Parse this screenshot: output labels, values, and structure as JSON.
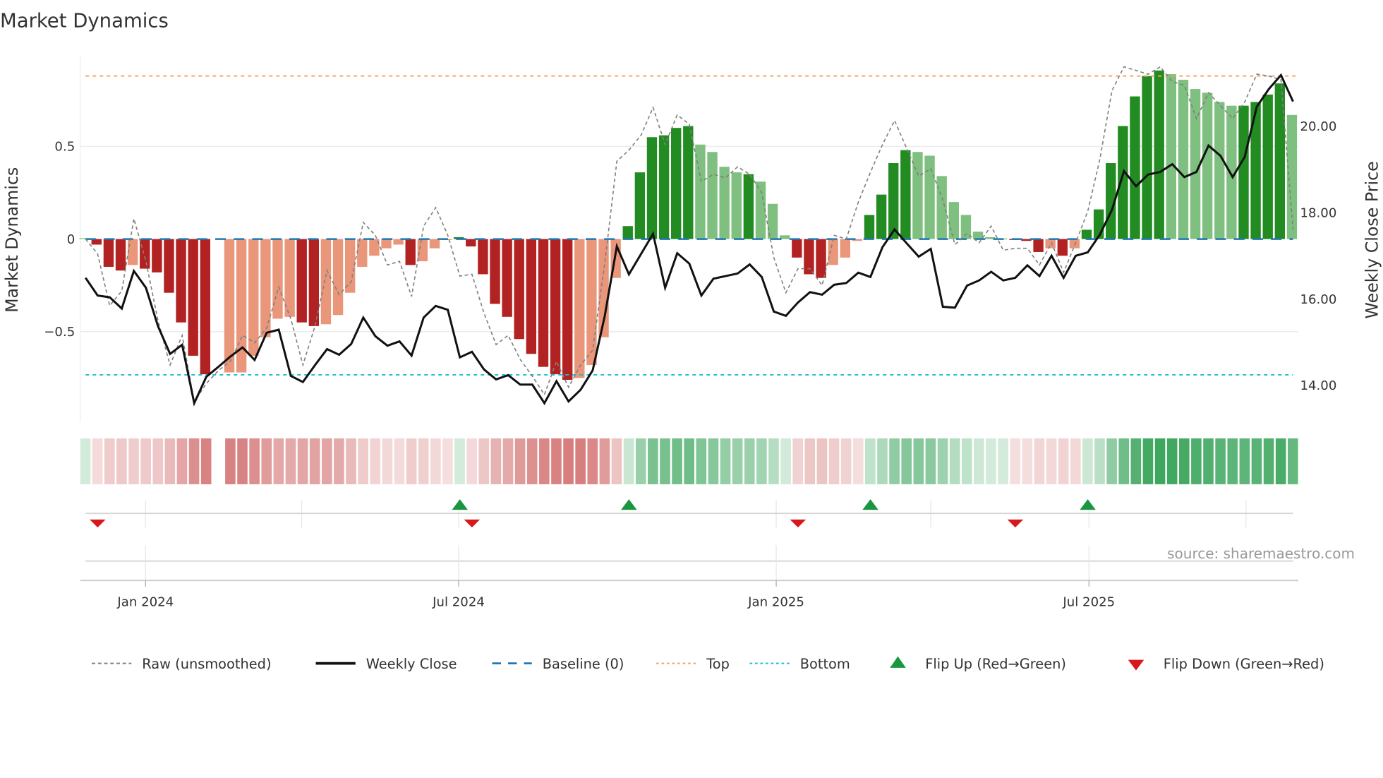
{
  "chart_data": {
    "type": "bar",
    "title": "Market Dynamics",
    "ylabel": "Market Dynamics",
    "y2label": "Weekly Close Price",
    "ylim": [
      -0.9,
      0.95
    ],
    "y2lim": [
      13.4,
      21.5
    ],
    "yticks": [
      {
        "value": 0.5,
        "label": "0.5"
      },
      {
        "value": 0,
        "label": "0"
      },
      {
        "value": -0.5,
        "label": "−0.5"
      }
    ],
    "y2ticks": [
      {
        "value": 20,
        "label": "20.00"
      },
      {
        "value": 18,
        "label": "18.00"
      },
      {
        "value": 16,
        "label": "16.00"
      },
      {
        "value": 14,
        "label": "14.00"
      }
    ],
    "xticks": [
      {
        "week": 4.97,
        "label": "Jan 2024"
      },
      {
        "week": 30.9,
        "label": "Jul 2024"
      },
      {
        "week": 57.2,
        "label": "Jan 2025"
      },
      {
        "week": 83.1,
        "label": "Jul 2025"
      }
    ],
    "minor_xticks": [
      17.9,
      70.0,
      96.1
    ],
    "top_level": 0.88,
    "bottom_level": -0.733,
    "baseline": 0,
    "dynamics": [
      0.005,
      -0.03,
      -0.15,
      -0.17,
      -0.14,
      -0.16,
      -0.18,
      -0.29,
      -0.45,
      -0.63,
      -0.73,
      null,
      -0.72,
      -0.72,
      -0.63,
      -0.53,
      -0.43,
      -0.42,
      -0.45,
      -0.47,
      -0.46,
      -0.41,
      -0.29,
      -0.15,
      -0.09,
      -0.05,
      -0.03,
      -0.14,
      -0.12,
      -0.05,
      -0.005,
      0.01,
      -0.04,
      -0.19,
      -0.35,
      -0.42,
      -0.54,
      -0.62,
      -0.69,
      -0.73,
      -0.76,
      -0.75,
      -0.68,
      -0.53,
      -0.21,
      0.07,
      0.36,
      0.55,
      0.56,
      0.6,
      0.61,
      0.51,
      0.47,
      0.39,
      0.36,
      0.35,
      0.31,
      0.19,
      0.02,
      -0.1,
      -0.19,
      -0.21,
      -0.14,
      -0.1,
      -0.01,
      0.13,
      0.24,
      0.41,
      0.48,
      0.47,
      0.45,
      0.34,
      0.2,
      0.13,
      0.04,
      0.01,
      0.003,
      -0.005,
      -0.01,
      -0.07,
      -0.05,
      -0.09,
      -0.05,
      0.05,
      0.16,
      0.41,
      0.61,
      0.77,
      0.88,
      0.91,
      0.89,
      0.86,
      0.81,
      0.79,
      0.74,
      0.72,
      0.72,
      0.74,
      0.78,
      0.84,
      0.67
    ],
    "bar_shade": [
      "lg",
      "dr",
      "dr",
      "dr",
      "lr",
      "dr",
      "dr",
      "dr",
      "dr",
      "dr",
      "dr",
      null,
      "lr",
      "lr",
      "lr",
      "lr",
      "lr",
      "lr",
      "dr",
      "dr",
      "lr",
      "lr",
      "lr",
      "lr",
      "lr",
      "lr",
      "lr",
      "dr",
      "lr",
      "lr",
      "lr",
      "dg",
      "dr",
      "dr",
      "dr",
      "dr",
      "dr",
      "dr",
      "dr",
      "dr",
      "dr",
      "lr",
      "lr",
      "lr",
      "lr",
      "dg",
      "dg",
      "dg",
      "dg",
      "dg",
      "dg",
      "lg",
      "lg",
      "lg",
      "lg",
      "dg",
      "lg",
      "lg",
      "lg",
      "dr",
      "dr",
      "dr",
      "lr",
      "lr",
      "lr",
      "dg",
      "dg",
      "dg",
      "dg",
      "lg",
      "lg",
      "lg",
      "lg",
      "lg",
      "lg",
      "lg",
      "lg",
      "dr",
      "dr",
      "dr",
      "lr",
      "dr",
      "lr",
      "dg",
      "dg",
      "dg",
      "dg",
      "dg",
      "dg",
      "dg",
      "lg",
      "lg",
      "lg",
      "lg",
      "lg",
      "lg",
      "dg",
      "dg",
      "dg",
      "dg",
      "lg"
    ],
    "raw": [
      0,
      -0.08,
      -0.36,
      -0.28,
      0.11,
      -0.12,
      -0.44,
      -0.68,
      -0.52,
      -0.88,
      -0.78,
      -0.71,
      -0.66,
      -0.52,
      -0.56,
      -0.48,
      -0.26,
      -0.43,
      -0.68,
      -0.47,
      -0.17,
      -0.3,
      -0.23,
      0.09,
      0.02,
      -0.14,
      -0.12,
      -0.31,
      0.07,
      0.17,
      0.02,
      -0.2,
      -0.19,
      -0.4,
      -0.57,
      -0.52,
      -0.65,
      -0.74,
      -0.84,
      -0.66,
      -0.8,
      -0.68,
      -0.6,
      -0.13,
      0.42,
      0.48,
      0.56,
      0.71,
      0.51,
      0.67,
      0.62,
      0.31,
      0.35,
      0.33,
      0.39,
      0.35,
      0.25,
      -0.1,
      -0.29,
      -0.16,
      -0.16,
      -0.25,
      0.02,
      0.0,
      0.2,
      0.36,
      0.51,
      0.64,
      0.49,
      0.34,
      0.38,
      0.21,
      -0.03,
      0.03,
      -0.02,
      0.07,
      -0.06,
      -0.05,
      -0.05,
      -0.14,
      -0.02,
      -0.18,
      -0.02,
      0.15,
      0.43,
      0.8,
      0.93,
      0.91,
      0.89,
      0.93,
      0.85,
      0.83,
      0.65,
      0.79,
      0.72,
      0.65,
      0.74,
      0.89,
      0.88,
      0.86,
      0.05
    ],
    "weekly_close": [
      16.47,
      16.06,
      16.02,
      15.76,
      16.63,
      16.24,
      15.35,
      14.71,
      14.92,
      13.57,
      14.18,
      14.41,
      14.65,
      14.86,
      14.57,
      15.2,
      15.27,
      14.2,
      14.06,
      14.45,
      14.82,
      14.69,
      14.94,
      15.55,
      15.12,
      14.9,
      15.0,
      14.67,
      15.55,
      15.82,
      15.73,
      14.63,
      14.76,
      14.35,
      14.12,
      14.22,
      14.0,
      14.0,
      13.57,
      14.08,
      13.61,
      13.88,
      14.33,
      15.59,
      17.2,
      16.55,
      17.02,
      17.49,
      16.24,
      17.04,
      16.8,
      16.06,
      16.45,
      16.51,
      16.57,
      16.78,
      16.49,
      15.69,
      15.59,
      15.9,
      16.14,
      16.08,
      16.31,
      16.35,
      16.59,
      16.49,
      17.18,
      17.59,
      17.27,
      16.96,
      17.14,
      15.8,
      15.78,
      16.29,
      16.41,
      16.61,
      16.41,
      16.47,
      16.76,
      16.51,
      16.98,
      16.47,
      16.98,
      17.06,
      17.47,
      18.04,
      18.94,
      18.59,
      18.86,
      18.92,
      19.1,
      18.8,
      18.92,
      19.53,
      19.29,
      18.8,
      19.27,
      20.43,
      20.84,
      21.16,
      20.55
    ],
    "flips": [
      {
        "week": 1,
        "type": "down"
      },
      {
        "week": 31,
        "type": "up"
      },
      {
        "week": 32,
        "type": "down"
      },
      {
        "week": 45,
        "type": "up"
      },
      {
        "week": 59,
        "type": "down"
      },
      {
        "week": 65,
        "type": "up"
      },
      {
        "week": 77,
        "type": "down"
      },
      {
        "week": 83,
        "type": "up"
      }
    ],
    "colors": {
      "dr": "#b22222",
      "lr": "#e9967a",
      "dg": "#228b22",
      "lg": "#7fbf7f",
      "raw": "#808080",
      "close": "#111111",
      "baseline": "#1f77b4",
      "top": "#f4a460",
      "bottom": "#17becf",
      "flip_up": "#1a9641",
      "flip_down": "#d7191c"
    },
    "legend": [
      {
        "key": "raw",
        "label": "Raw (unsmoothed)"
      },
      {
        "key": "close",
        "label": "Weekly Close"
      },
      {
        "key": "baseline",
        "label": "Baseline (0)"
      },
      {
        "key": "top",
        "label": "Top"
      },
      {
        "key": "bottom",
        "label": "Bottom"
      },
      {
        "key": "flip_up",
        "label": "Flip Up (Red→Green)"
      },
      {
        "key": "flip_down",
        "label": "Flip Down (Green→Red)"
      }
    ],
    "source": "source: sharemaestro.com"
  }
}
